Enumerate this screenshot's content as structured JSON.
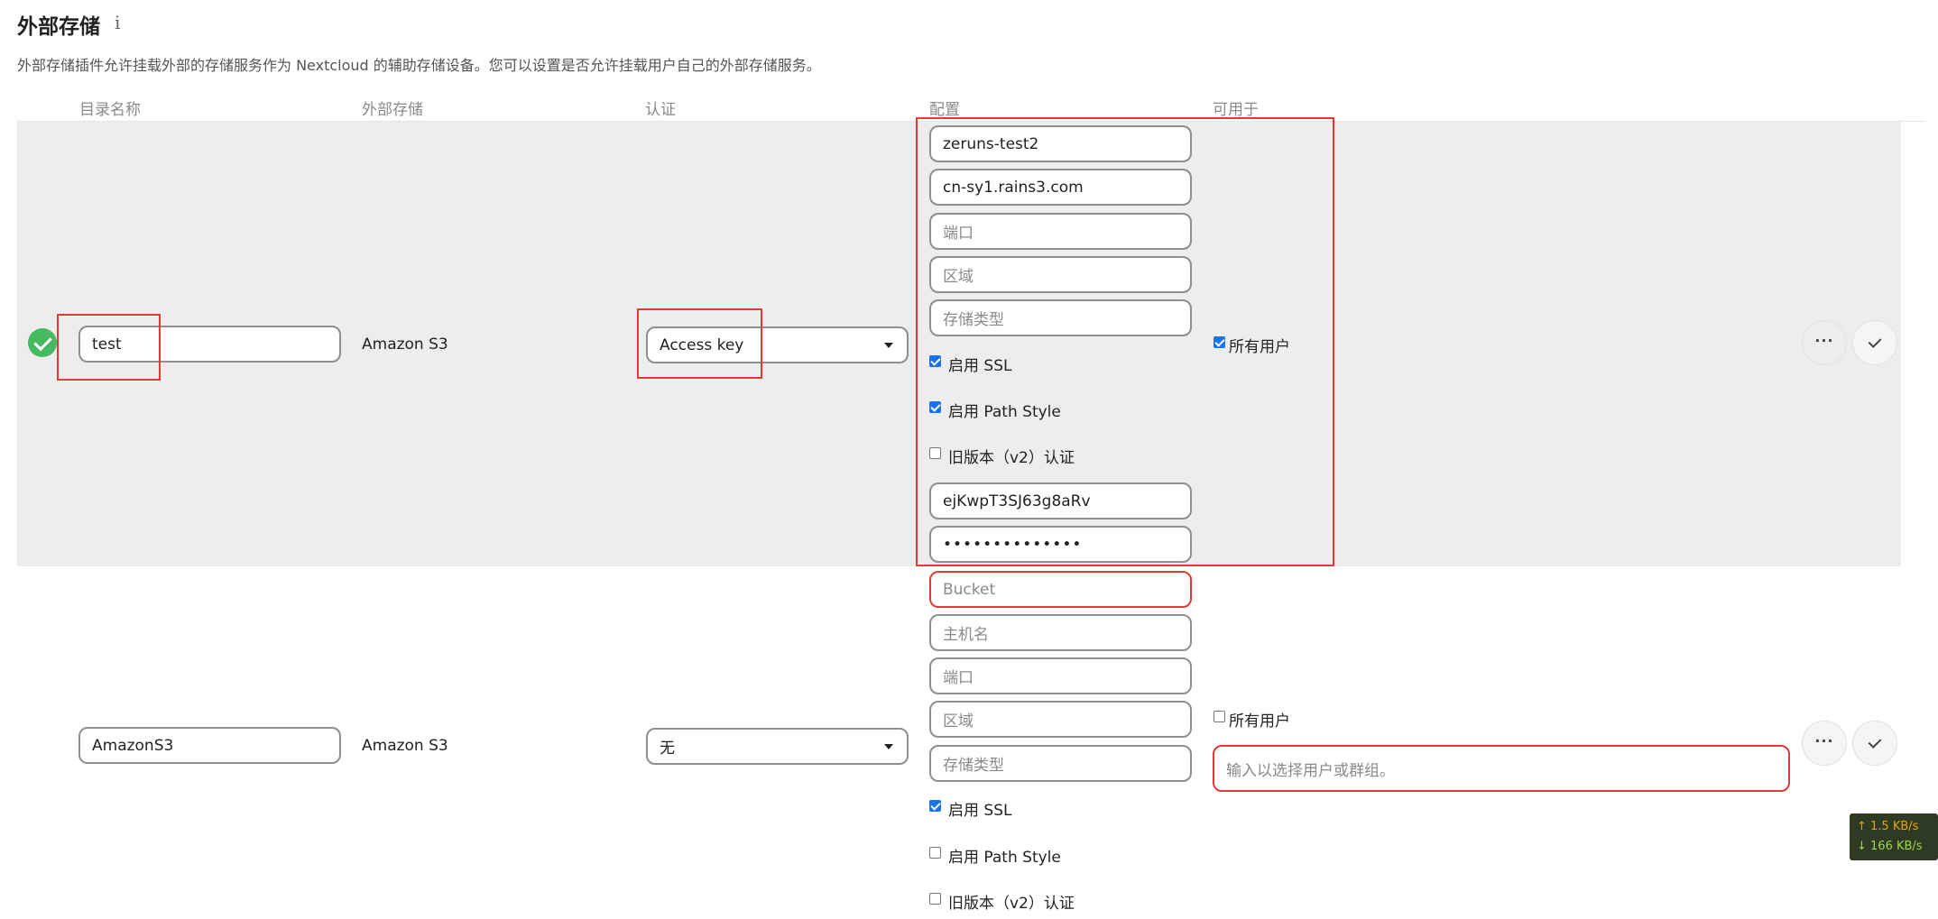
{
  "header": {
    "title": "外部存储",
    "info_icon": "i",
    "description": "外部存储插件允许挂载外部的存储服务作为 Nextcloud 的辅助存储设备。您可以设置是否允许挂载用户自己的外部存储服务。"
  },
  "columns": {
    "folder_name": "目录名称",
    "external_storage": "外部存储",
    "authentication": "认证",
    "configuration": "配置",
    "available_for": "可用于"
  },
  "rows": [
    {
      "folder_name": "test",
      "backend": "Amazon S3",
      "auth": "Access key",
      "config": {
        "bucket": "zeruns-test2",
        "hostname": "cn-sy1.rains3.com",
        "port_placeholder": "端口",
        "region_placeholder": "区域",
        "storage_class_placeholder": "存储类型",
        "enable_ssl": "启用 SSL",
        "enable_path_style": "启用 Path Style",
        "legacy_auth": "旧版本（v2）认证",
        "access_key": "ejKwpT3SJ63g8aRv",
        "secret_masked": "••••••••••••••"
      },
      "available_for": "所有用户"
    },
    {
      "folder_name": "AmazonS3",
      "backend": "Amazon S3",
      "auth": "无",
      "config": {
        "bucket_placeholder": "Bucket",
        "hostname_placeholder": "主机名",
        "port_placeholder": "端口",
        "region_placeholder": "区域",
        "storage_class_placeholder": "存储类型",
        "enable_ssl": "启用 SSL",
        "enable_path_style": "启用 Path Style",
        "legacy_auth": "旧版本（v2）认证"
      },
      "available_for": "所有用户",
      "user_group_placeholder": "输入以选择用户或群组。"
    }
  ],
  "speed": {
    "up": "↑ 1.5 KB/s",
    "down": "↓ 166 KB/s"
  },
  "colors": {
    "accent_red": "#e53935",
    "success_green": "#46ba61",
    "checkbox_blue": "#1a73e8"
  },
  "icons": [
    "info-icon",
    "check-circle-icon",
    "more-icon",
    "checkmark-icon",
    "chevron-down-icon"
  ]
}
